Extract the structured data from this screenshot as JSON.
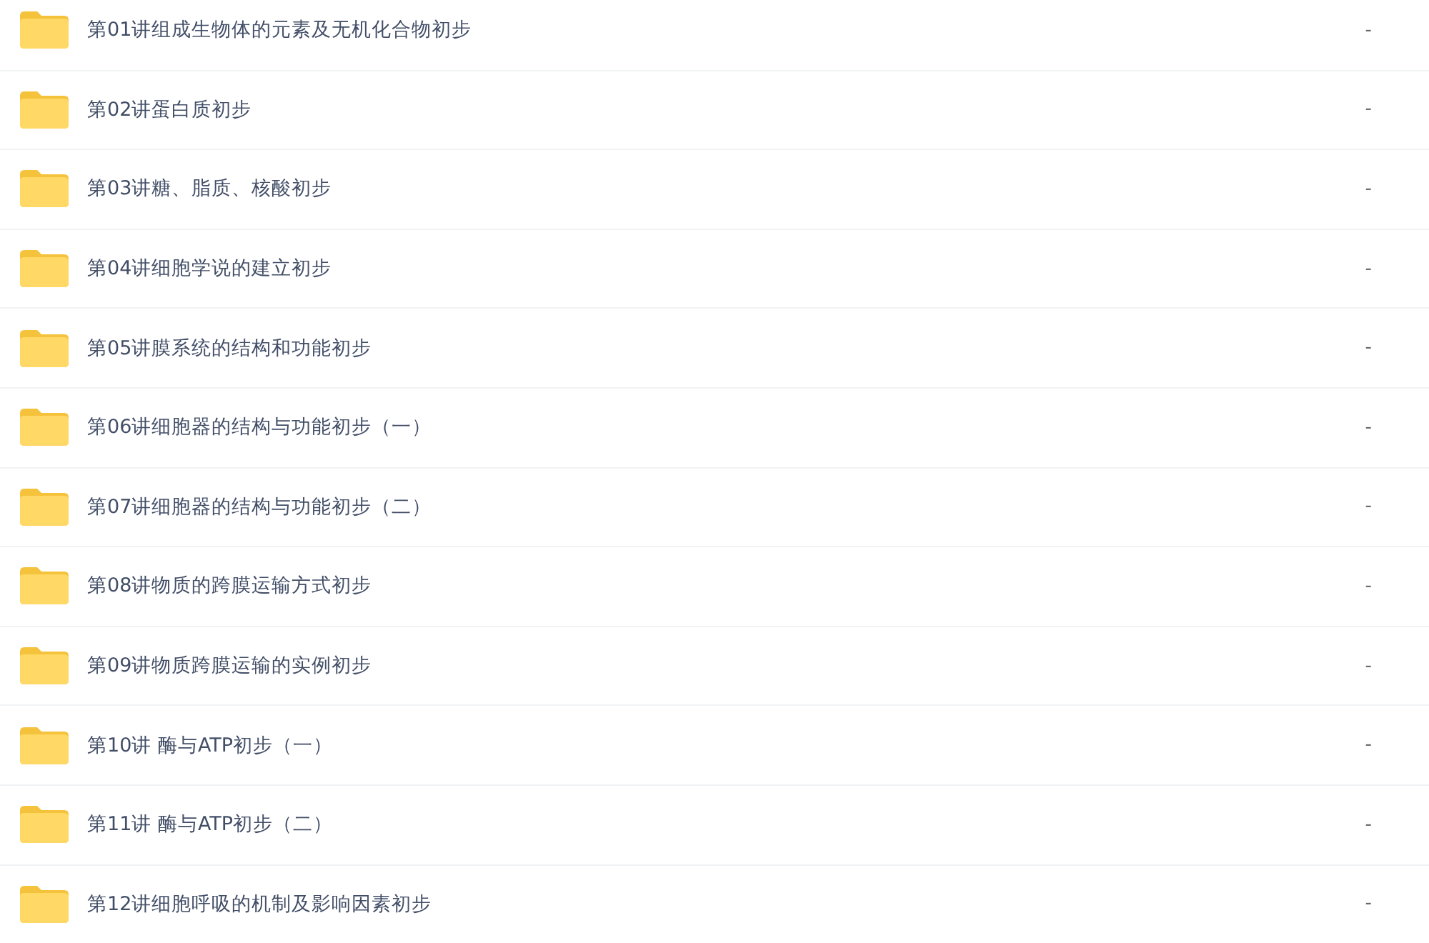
{
  "files": [
    {
      "name": "第01讲组成生物体的元素及无机化合物初步",
      "size": "-"
    },
    {
      "name": "第02讲蛋白质初步",
      "size": "-"
    },
    {
      "name": "第03讲糖、脂质、核酸初步",
      "size": "-"
    },
    {
      "name": "第04讲细胞学说的建立初步",
      "size": "-"
    },
    {
      "name": "第05讲膜系统的结构和功能初步",
      "size": "-"
    },
    {
      "name": "第06讲细胞器的结构与功能初步（一）",
      "size": "-"
    },
    {
      "name": "第07讲细胞器的结构与功能初步（二）",
      "size": "-"
    },
    {
      "name": "第08讲物质的跨膜运输方式初步",
      "size": "-"
    },
    {
      "name": "第09讲物质跨膜运输的实例初步",
      "size": "-"
    },
    {
      "name": "第10讲 酶与ATP初步（一）",
      "size": "-"
    },
    {
      "name": "第11讲 酶与ATP初步（二）",
      "size": "-"
    },
    {
      "name": "第12讲细胞呼吸的机制及影响因素初步",
      "size": "-"
    }
  ]
}
